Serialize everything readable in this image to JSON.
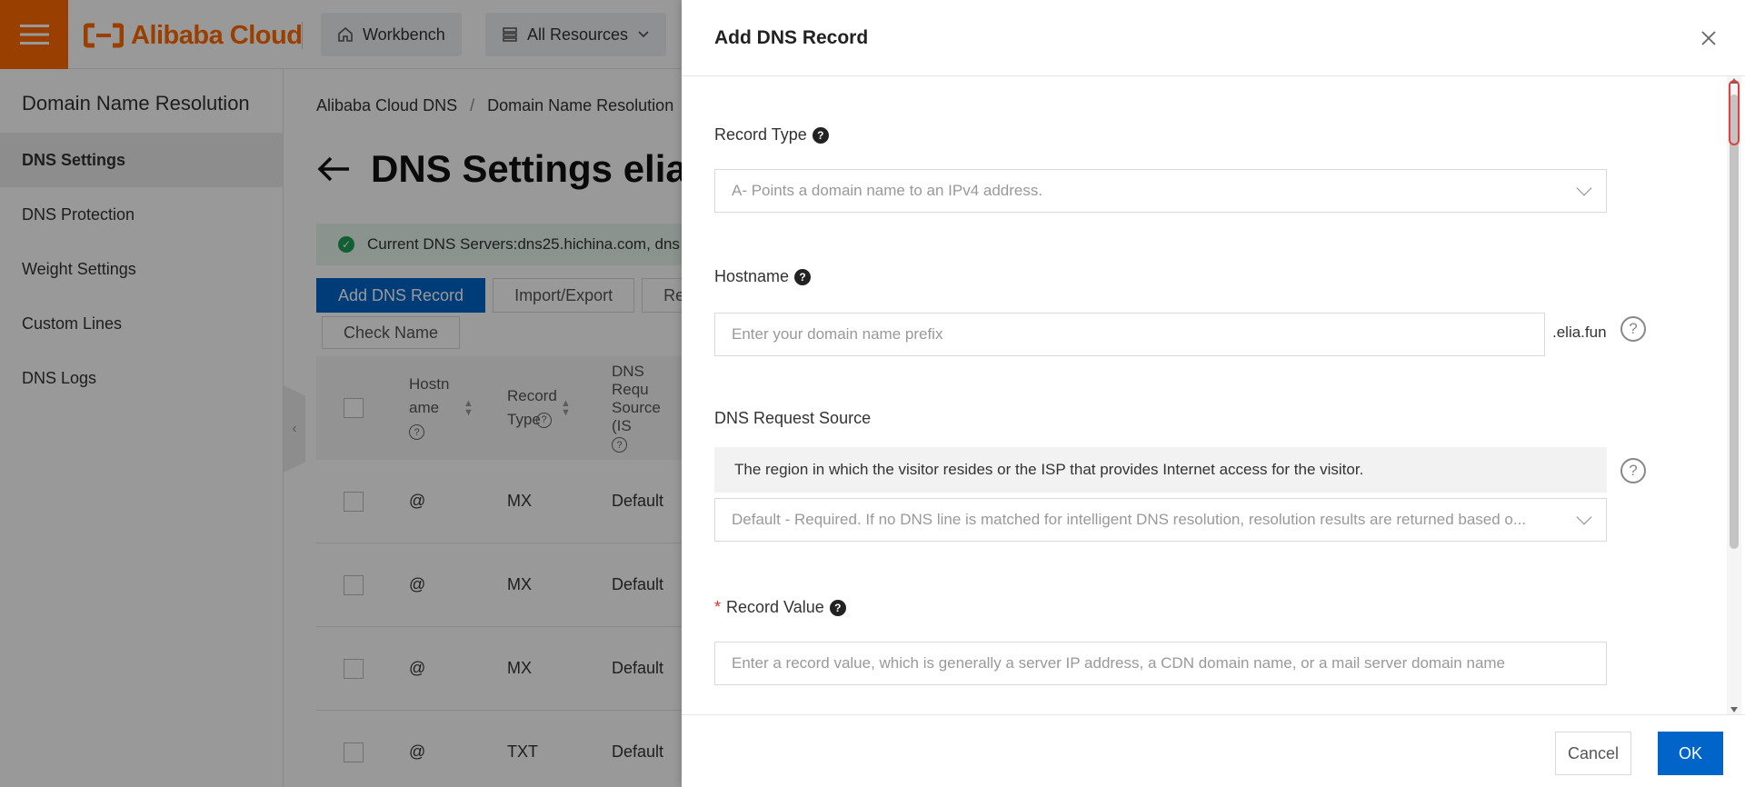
{
  "topbar": {
    "logo_text": "Alibaba Cloud",
    "workbench": "Workbench",
    "all_resources": "All Resources"
  },
  "sidebar": {
    "title": "Domain Name Resolution",
    "items": [
      {
        "label": "DNS Settings",
        "active": true
      },
      {
        "label": "DNS Protection"
      },
      {
        "label": "Weight Settings"
      },
      {
        "label": "Custom Lines"
      },
      {
        "label": "DNS Logs"
      }
    ]
  },
  "main": {
    "breadcrumb": [
      "Alibaba Cloud DNS",
      "Domain Name Resolution"
    ],
    "breadcrumb_sep": "/",
    "title": "DNS Settings elia",
    "alert": "Current DNS Servers:dns25.hichina.com, dns",
    "buttons": {
      "add": "Add DNS Record",
      "import_export": "Import/Export",
      "third": "Re",
      "check_name": "Check Name"
    },
    "table": {
      "headers": {
        "hostname": "Hostn ame",
        "record_type": "Record Type",
        "source": "DNS Requ Source (IS"
      },
      "rows": [
        {
          "host": "@",
          "type": "MX",
          "source": "Default"
        },
        {
          "host": "@",
          "type": "MX",
          "source": "Default"
        },
        {
          "host": "@",
          "type": "MX",
          "source": "Default"
        },
        {
          "host": "@",
          "type": "TXT",
          "source": "Default"
        }
      ]
    }
  },
  "drawer": {
    "title": "Add DNS Record",
    "record_type": {
      "label": "Record Type",
      "value": "A- Points a domain name to an IPv4 address."
    },
    "hostname": {
      "label": "Hostname",
      "placeholder": "Enter your domain name prefix",
      "suffix": ".elia.fun"
    },
    "dns_source": {
      "label": "DNS Request Source",
      "info": "The region in which the visitor resides or the ISP that provides Internet access for the visitor.",
      "value": "Default - Required. If no DNS line is matched for intelligent DNS resolution, resolution results are returned based o..."
    },
    "record_value": {
      "required_mark": "*",
      "label": "Record Value",
      "placeholder": "Enter a record value, which is generally a server IP address, a CDN domain name, or a mail server domain name"
    },
    "cancel": "Cancel",
    "ok": "OK"
  },
  "colors": {
    "brand_orange": "#ff6a00",
    "primary_blue": "#0064c8",
    "success_green": "#1e9e57",
    "required_red": "#d93026"
  },
  "icons": {
    "menu": "hamburger-icon",
    "home": "home-icon",
    "resources": "list-icon",
    "close": "close-icon",
    "help": "question-icon",
    "success": "check-circle-icon",
    "back": "arrow-left-icon"
  }
}
